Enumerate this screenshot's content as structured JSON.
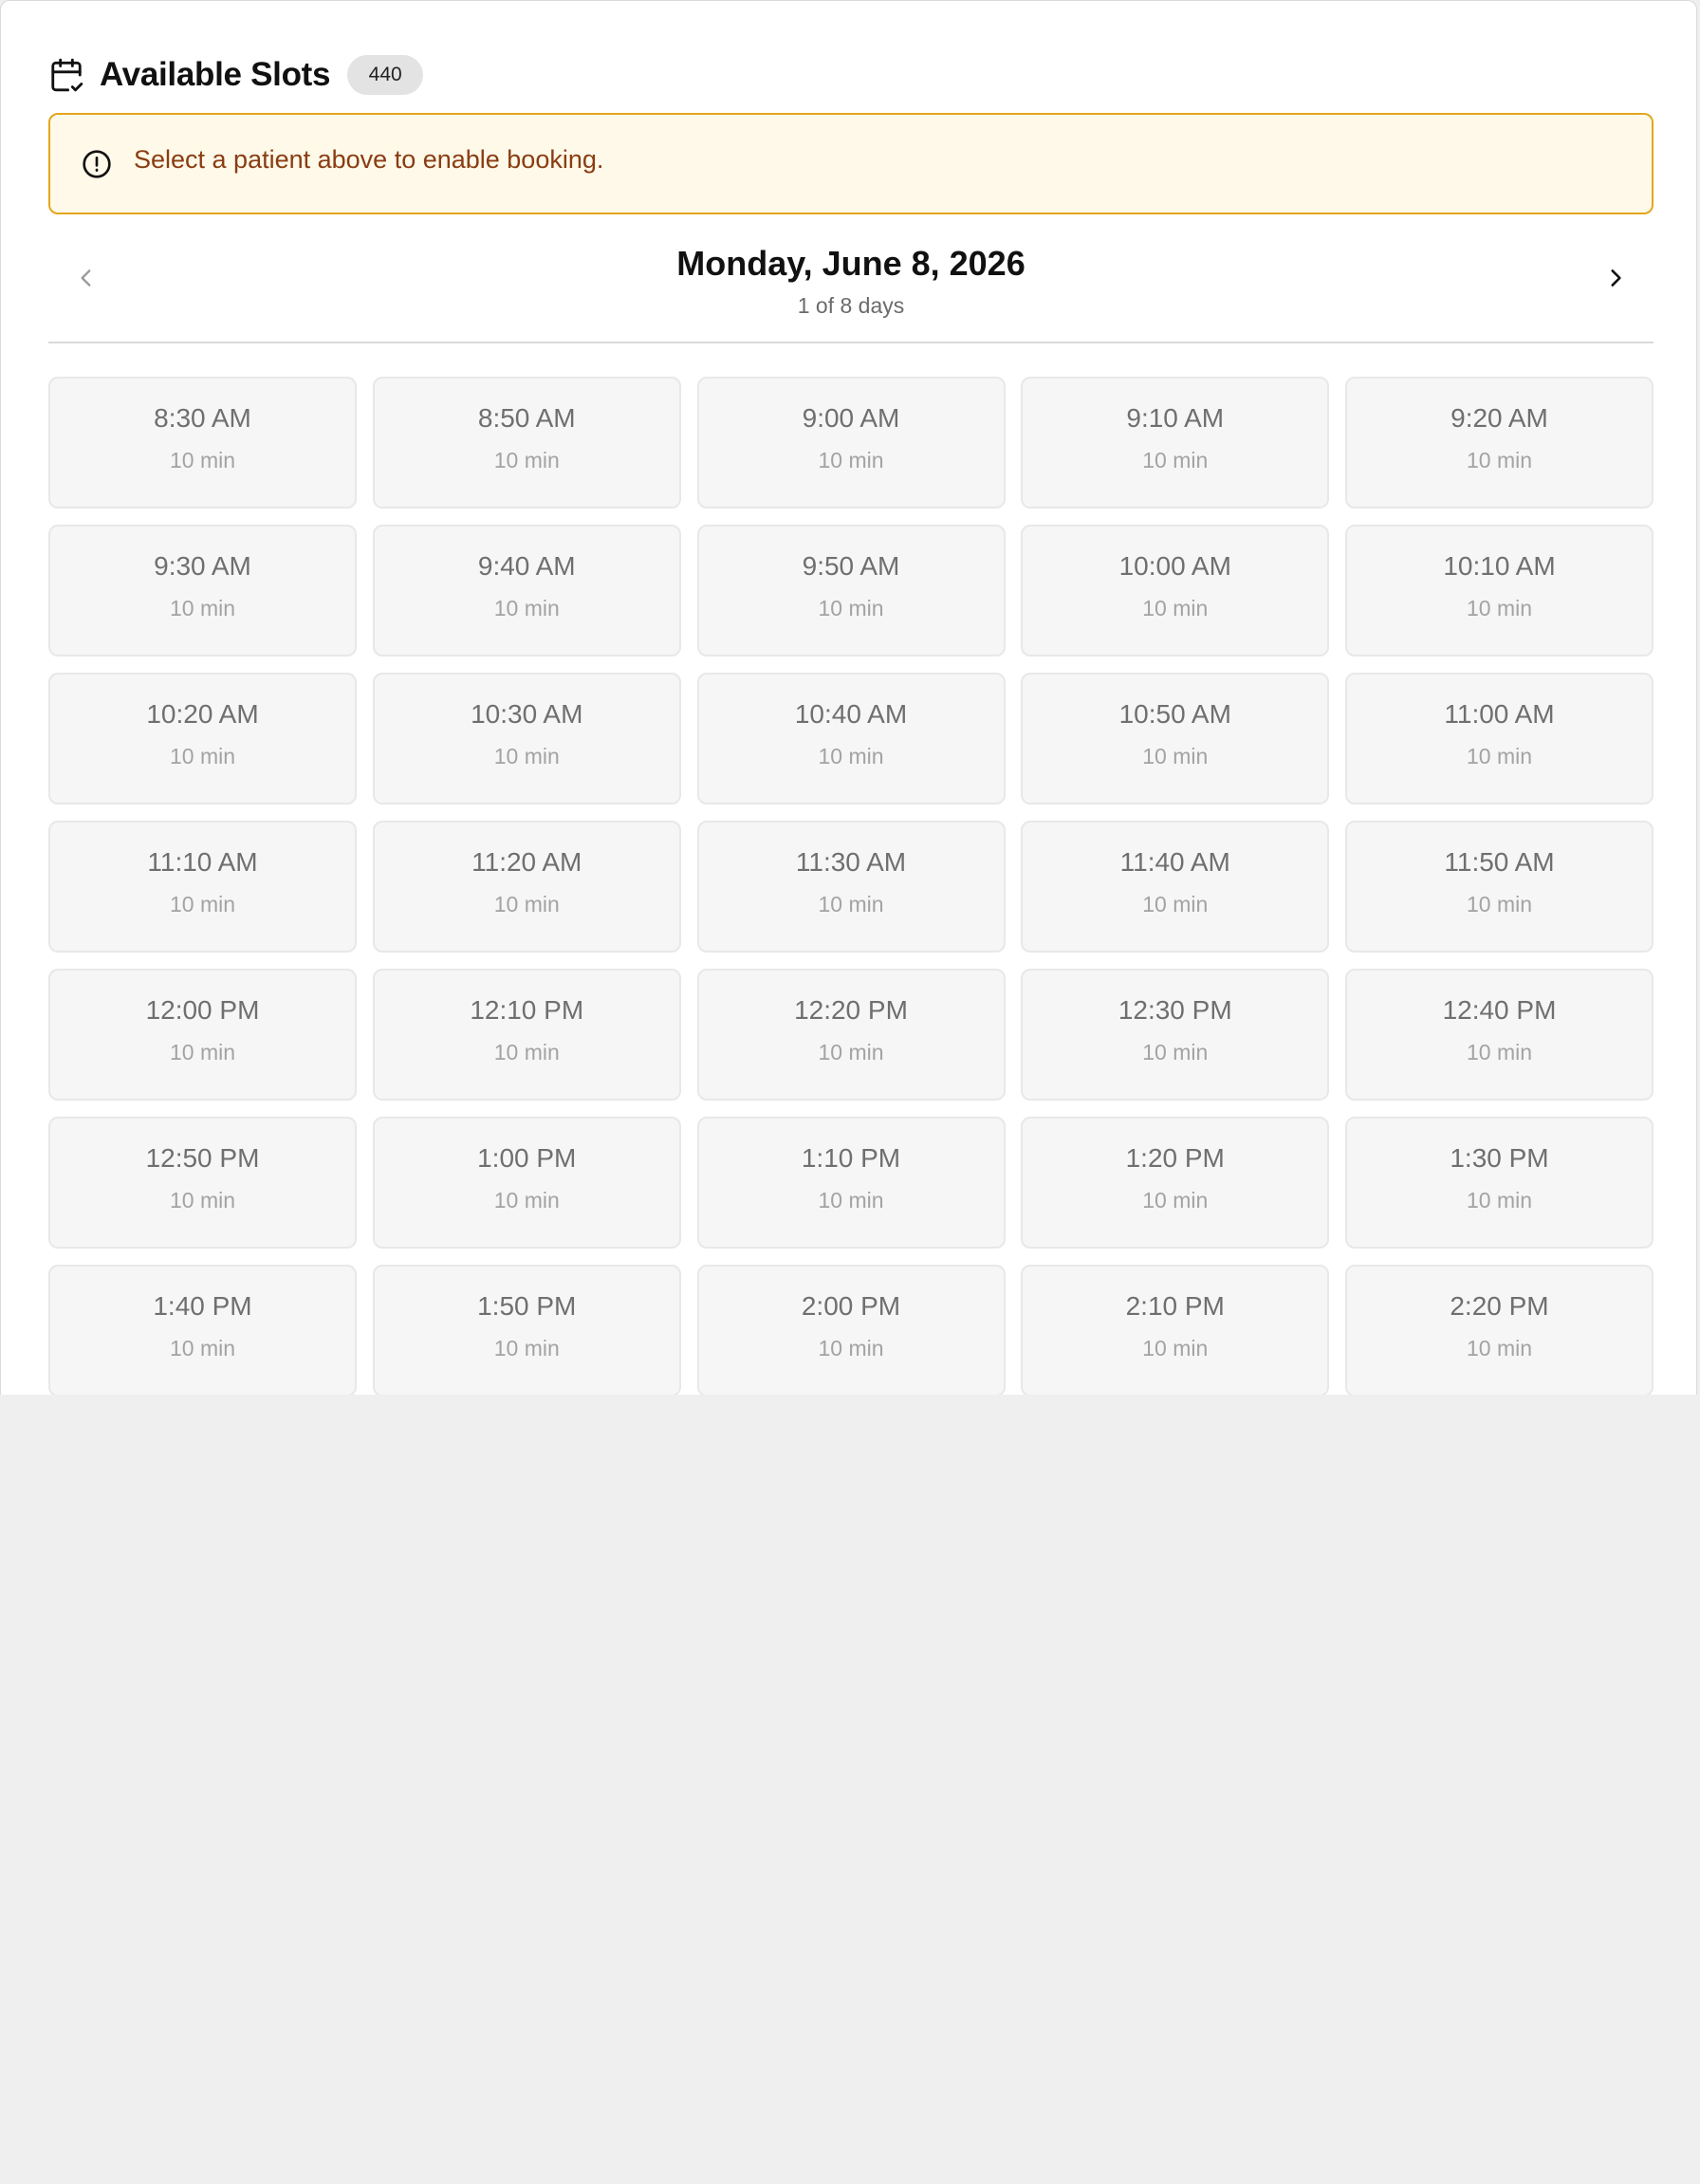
{
  "header": {
    "title": "Available Slots",
    "count": "440"
  },
  "alert": {
    "message": "Select a patient above to enable booking."
  },
  "day_nav": {
    "date": "Monday, June 8, 2026",
    "position": "1 of 8 days"
  },
  "slots": [
    {
      "time": "8:30 AM",
      "duration": "10 min"
    },
    {
      "time": "8:50 AM",
      "duration": "10 min"
    },
    {
      "time": "9:00 AM",
      "duration": "10 min"
    },
    {
      "time": "9:10 AM",
      "duration": "10 min"
    },
    {
      "time": "9:20 AM",
      "duration": "10 min"
    },
    {
      "time": "9:30 AM",
      "duration": "10 min"
    },
    {
      "time": "9:40 AM",
      "duration": "10 min"
    },
    {
      "time": "9:50 AM",
      "duration": "10 min"
    },
    {
      "time": "10:00 AM",
      "duration": "10 min"
    },
    {
      "time": "10:10 AM",
      "duration": "10 min"
    },
    {
      "time": "10:20 AM",
      "duration": "10 min"
    },
    {
      "time": "10:30 AM",
      "duration": "10 min"
    },
    {
      "time": "10:40 AM",
      "duration": "10 min"
    },
    {
      "time": "10:50 AM",
      "duration": "10 min"
    },
    {
      "time": "11:00 AM",
      "duration": "10 min"
    },
    {
      "time": "11:10 AM",
      "duration": "10 min"
    },
    {
      "time": "11:20 AM",
      "duration": "10 min"
    },
    {
      "time": "11:30 AM",
      "duration": "10 min"
    },
    {
      "time": "11:40 AM",
      "duration": "10 min"
    },
    {
      "time": "11:50 AM",
      "duration": "10 min"
    },
    {
      "time": "12:00 PM",
      "duration": "10 min"
    },
    {
      "time": "12:10 PM",
      "duration": "10 min"
    },
    {
      "time": "12:20 PM",
      "duration": "10 min"
    },
    {
      "time": "12:30 PM",
      "duration": "10 min"
    },
    {
      "time": "12:40 PM",
      "duration": "10 min"
    },
    {
      "time": "12:50 PM",
      "duration": "10 min"
    },
    {
      "time": "1:00 PM",
      "duration": "10 min"
    },
    {
      "time": "1:10 PM",
      "duration": "10 min"
    },
    {
      "time": "1:20 PM",
      "duration": "10 min"
    },
    {
      "time": "1:30 PM",
      "duration": "10 min"
    },
    {
      "time": "1:40 PM",
      "duration": "10 min"
    },
    {
      "time": "1:50 PM",
      "duration": "10 min"
    },
    {
      "time": "2:00 PM",
      "duration": "10 min"
    },
    {
      "time": "2:10 PM",
      "duration": "10 min"
    },
    {
      "time": "2:20 PM",
      "duration": "10 min"
    }
  ],
  "icons": {
    "header": "calendar-check-icon",
    "alert": "alert-circle-icon",
    "prev": "chevron-left-icon",
    "next": "chevron-right-icon"
  },
  "colors": {
    "alert_background": "#fef9e8",
    "alert_border": "#e3a61d",
    "alert_text": "#8a3c12",
    "slot_background": "#f6f6f6",
    "page_background": "#efefef"
  }
}
